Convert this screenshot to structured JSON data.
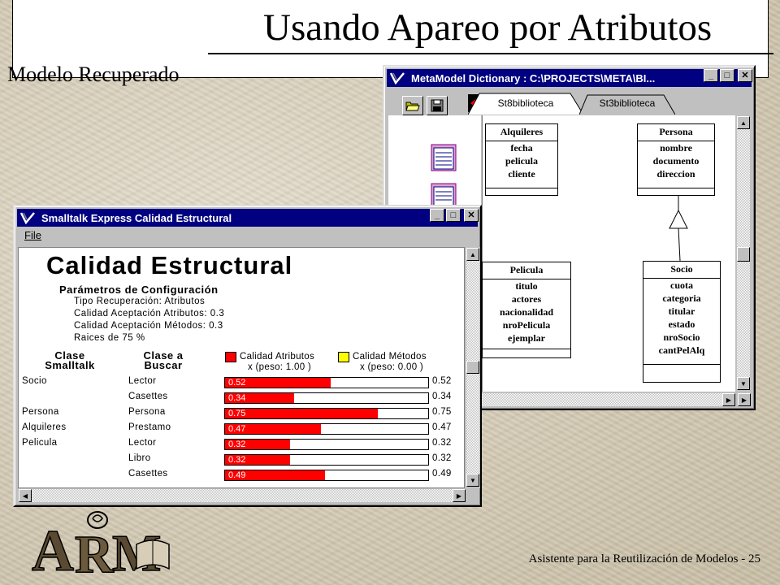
{
  "slide": {
    "title": "Usando Apareo por Atributos",
    "subtitle": "Modelo Recuperado",
    "footer": "Asistente para la Reutilización de Modelos - 25",
    "logo_text": "ARM"
  },
  "metamodel_window": {
    "title": "MetaModel Dictionary : C:\\PROJECTS\\META\\BI...",
    "tabs": [
      "St8biblioteca",
      "St3biblioteca"
    ],
    "classes": [
      {
        "name": "Alquileres",
        "attributes": [
          "fecha",
          "pelicula",
          "cliente"
        ]
      },
      {
        "name": "Persona",
        "attributes": [
          "nombre",
          "documento",
          "direccion"
        ]
      },
      {
        "name": "Pelicula",
        "attributes": [
          "titulo",
          "actores",
          "nacionalidad",
          "nroPelicula",
          "ejemplar"
        ]
      },
      {
        "name": "Socio",
        "attributes": [
          "cuota",
          "categoria",
          "titular",
          "estado",
          "nroSocio",
          "cantPelAlq"
        ]
      }
    ]
  },
  "calidad_window": {
    "title": "Smalltalk Express Calidad Estructural",
    "menu": [
      "File"
    ],
    "heading": "Calidad Estructural",
    "params_heading": "Parámetros de Configuración",
    "params": [
      "Tipo Recuperación: Atributos",
      "Calidad Aceptación Atributos: 0.3",
      "Calidad Aceptación Métodos: 0.3",
      "Raices de 75 %"
    ],
    "col_clase_smalltalk": [
      "Clase",
      "Smalltalk"
    ],
    "col_clase_buscar": [
      "Clase a",
      "Buscar"
    ],
    "legend": {
      "atributos": "Calidad Atributos",
      "atributos_peso": "x (peso: 1.00 )",
      "metodos": "Calidad Métodos",
      "metodos_peso": "x (peso: 0.00 )",
      "atributos_color": "#ff0000",
      "metodos_color": "#ffff00"
    },
    "rows": [
      {
        "smalltalk": "Socio",
        "buscar": "Lector",
        "value": 0.52,
        "label": "0.52"
      },
      {
        "smalltalk": "",
        "buscar": "Casettes",
        "value": 0.34,
        "label": "0.34"
      },
      {
        "smalltalk": "Persona",
        "buscar": "Persona",
        "value": 0.75,
        "label": "0.75"
      },
      {
        "smalltalk": "Alquileres",
        "buscar": "Prestamo",
        "value": 0.47,
        "label": "0.47"
      },
      {
        "smalltalk": "Pelicula",
        "buscar": "Lector",
        "value": 0.32,
        "label": "0.32"
      },
      {
        "smalltalk": "",
        "buscar": "Libro",
        "value": 0.32,
        "label": "0.32"
      },
      {
        "smalltalk": "",
        "buscar": "Casettes",
        "value": 0.49,
        "label": "0.49"
      }
    ]
  }
}
